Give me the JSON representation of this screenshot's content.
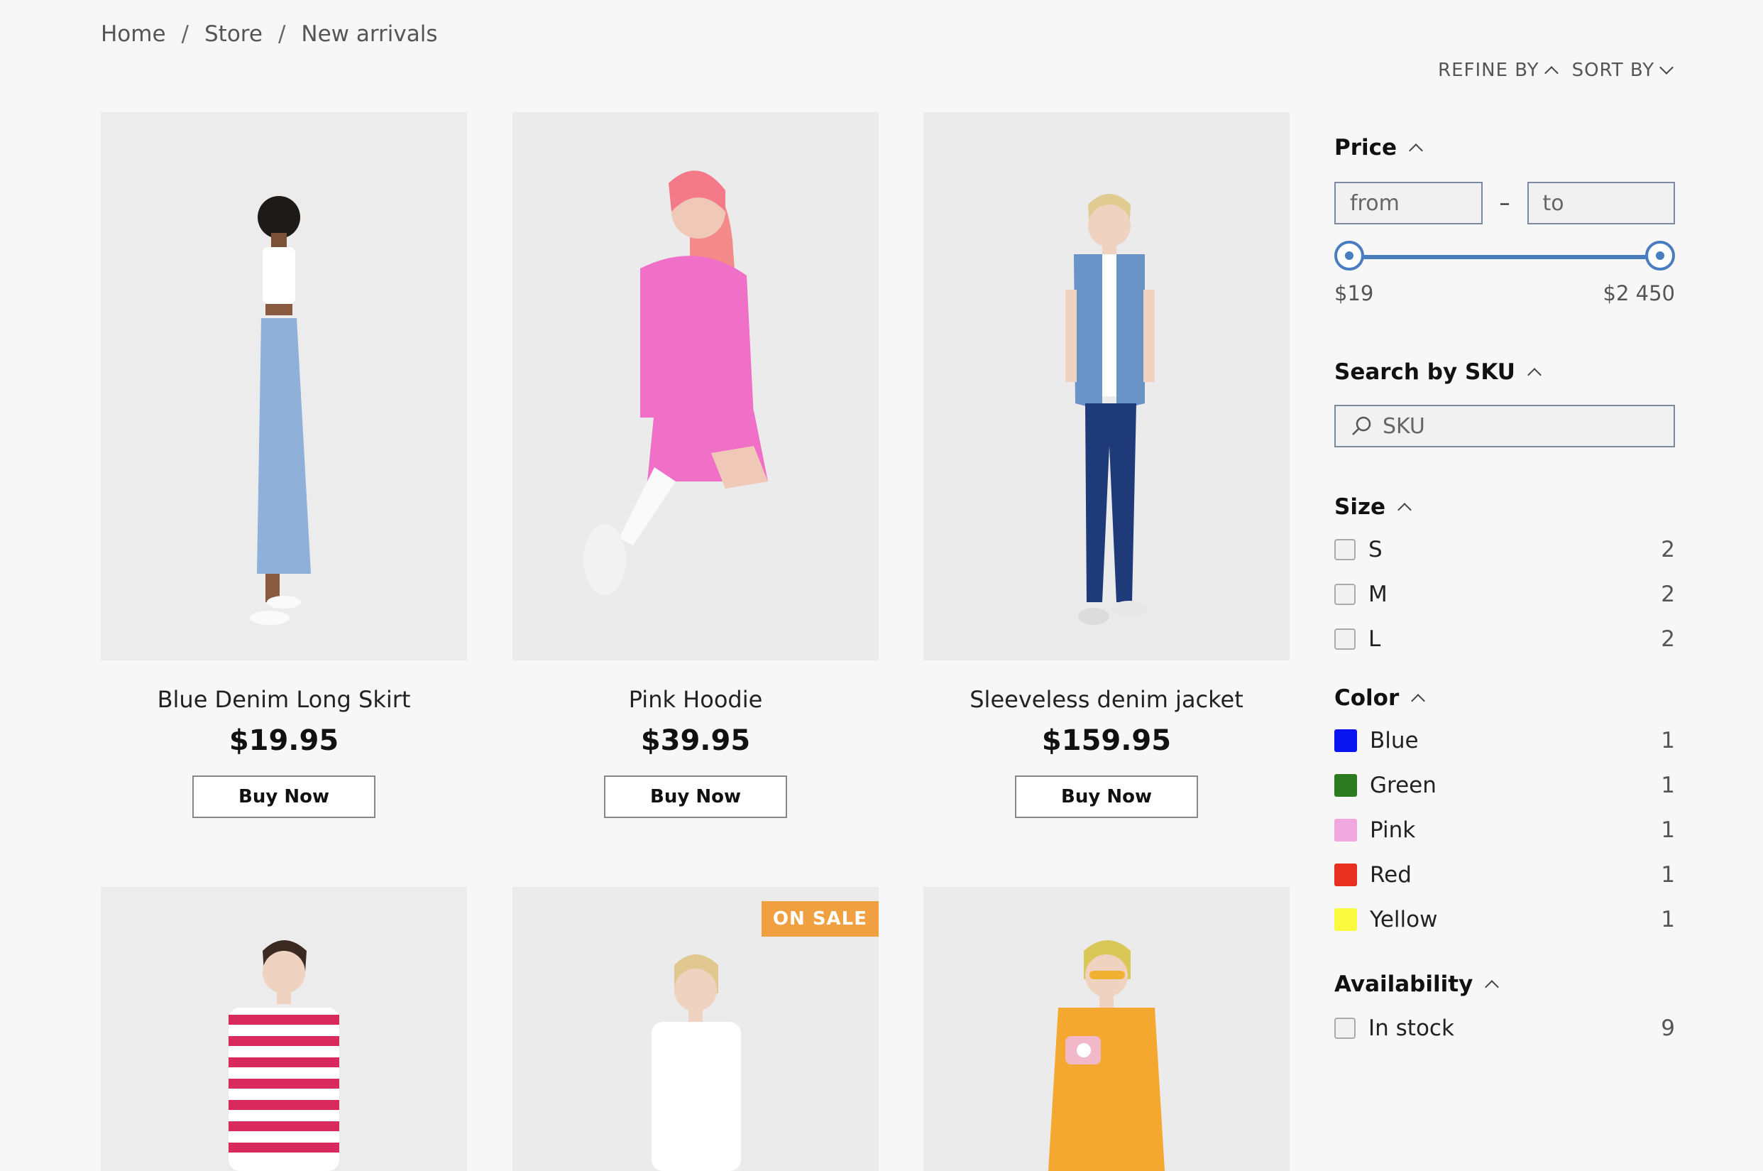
{
  "breadcrumb": [
    "Home",
    "Store",
    "New arrivals"
  ],
  "toolbar": {
    "refine_label": "REFINE BY",
    "sort_label": "SORT BY"
  },
  "products": [
    {
      "name": "Blue Denim Long Skirt",
      "price": "$19.95",
      "button": "Buy Now"
    },
    {
      "name": "Pink Hoodie",
      "price": "$39.95",
      "button": "Buy Now"
    },
    {
      "name": "Sleeveless denim jacket",
      "price": "$159.95",
      "button": "Buy Now"
    },
    {
      "badge": ""
    },
    {
      "badge": "ON SALE"
    },
    {
      "badge": ""
    }
  ],
  "filters": {
    "price": {
      "title": "Price",
      "from_placeholder": "from",
      "to_placeholder": "to",
      "separator": "–",
      "min_label": "$19",
      "max_label": "$2 450"
    },
    "sku": {
      "title": "Search by SKU",
      "placeholder": "SKU"
    },
    "size": {
      "title": "Size",
      "options": [
        {
          "label": "S",
          "count": "2"
        },
        {
          "label": "M",
          "count": "2"
        },
        {
          "label": "L",
          "count": "2"
        }
      ]
    },
    "color": {
      "title": "Color",
      "options": [
        {
          "label": "Blue",
          "count": "1",
          "swatch": "#0a14f0"
        },
        {
          "label": "Green",
          "count": "1",
          "swatch": "#2e7a20"
        },
        {
          "label": "Pink",
          "count": "1",
          "swatch": "#f0a8e0"
        },
        {
          "label": "Red",
          "count": "1",
          "swatch": "#e83020"
        },
        {
          "label": "Yellow",
          "count": "1",
          "swatch": "#fafa40"
        }
      ]
    },
    "availability": {
      "title": "Availability",
      "options": [
        {
          "label": "In stock",
          "count": "9"
        }
      ]
    }
  }
}
